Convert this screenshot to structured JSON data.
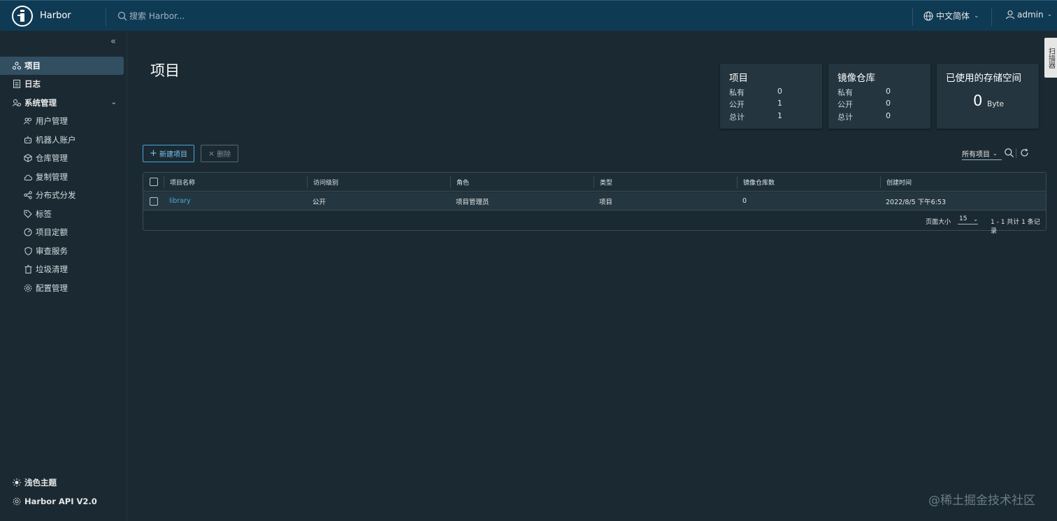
{
  "header": {
    "brand": "Harbor",
    "search_placeholder": "搜索 Harbor...",
    "language": "中文简体",
    "user": "admin"
  },
  "sidebar": {
    "items": [
      {
        "label": "项目",
        "icon": "projects-icon",
        "active": true
      },
      {
        "label": "日志",
        "icon": "log-icon"
      },
      {
        "label": "系统管理",
        "icon": "admin-icon"
      }
    ],
    "sub_items": [
      {
        "label": "用户管理",
        "icon": "users-icon"
      },
      {
        "label": "机器人账户",
        "icon": "robot-icon"
      },
      {
        "label": "仓库管理",
        "icon": "registry-icon"
      },
      {
        "label": "复制管理",
        "icon": "cloud-copy-icon"
      },
      {
        "label": "分布式分发",
        "icon": "share-icon"
      },
      {
        "label": "标签",
        "icon": "tag-icon"
      },
      {
        "label": "项目定额",
        "icon": "quota-icon"
      },
      {
        "label": "审查服务",
        "icon": "shield-icon"
      },
      {
        "label": "垃圾清理",
        "icon": "trash-icon"
      },
      {
        "label": "配置管理",
        "icon": "gear-icon"
      }
    ],
    "theme_label": "浅色主题",
    "api_label": "Harbor API V2.0"
  },
  "main": {
    "title": "项目",
    "cards": {
      "projects": {
        "title": "项目",
        "rows": [
          {
            "label": "私有",
            "value": "0"
          },
          {
            "label": "公开",
            "value": "1"
          },
          {
            "label": "总计",
            "value": "1"
          }
        ]
      },
      "repos": {
        "title": "镜像仓库",
        "rows": [
          {
            "label": "私有",
            "value": "0"
          },
          {
            "label": "公开",
            "value": "0"
          },
          {
            "label": "总计",
            "value": "0"
          }
        ]
      },
      "storage": {
        "title": "已使用的存储空间",
        "value": "0",
        "unit": "Byte"
      }
    },
    "new_button": "新建项目",
    "delete_button": "删除",
    "filter": "所有项目"
  },
  "table": {
    "columns": [
      "项目名称",
      "访问级别",
      "角色",
      "类型",
      "镜像仓库数",
      "创建时间"
    ],
    "rows": [
      {
        "name": "library",
        "access": "公开",
        "role": "项目管理员",
        "type": "项目",
        "repo_count": "0",
        "created": "2022/8/5 下午6:53"
      }
    ],
    "footer": {
      "page_size_label": "页面大小",
      "page_size": "15",
      "count": "1 - 1 共计 1 条记录"
    }
  },
  "side_tab": "扫描器",
  "watermark": "@稀土掘金技术社区"
}
